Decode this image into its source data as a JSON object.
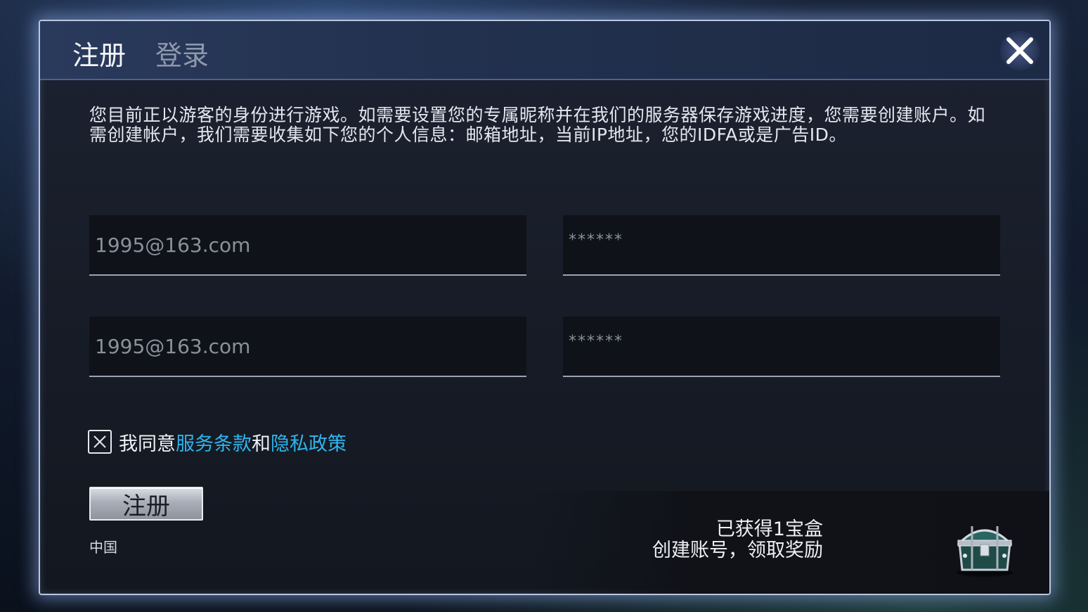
{
  "dialog": {
    "tabs": [
      {
        "label": "注册",
        "active": true
      },
      {
        "label": "登录",
        "active": false
      }
    ],
    "close_icon": "close-icon",
    "info": "您目前正以游客的身份进行游戏。如需要设置您的专属昵称并在我们的服务器保存游戏进度，您需要创建账户。如需创建帐户，我们需要收集如下您的个人信息：邮箱地址，当前IP地址，您的IDFA或是广告ID。",
    "fields": [
      {
        "placeholder": "1995@163.com"
      },
      {
        "placeholder": "******"
      },
      {
        "placeholder": "1995@163.com"
      },
      {
        "placeholder": "******"
      }
    ],
    "agree": {
      "prefix": "我同意",
      "terms": "服务条款",
      "and": "和",
      "privacy": "隐私政策",
      "checked": true
    },
    "register_button": "注册",
    "region": "中国",
    "reward": {
      "line1": "已获得1宝盒",
      "line2": "创建账号，领取奖励",
      "icon": "treasure-chest-icon"
    }
  },
  "colors": {
    "accent_link": "#31b4ec",
    "frame_glow": "#b9c7e0"
  }
}
